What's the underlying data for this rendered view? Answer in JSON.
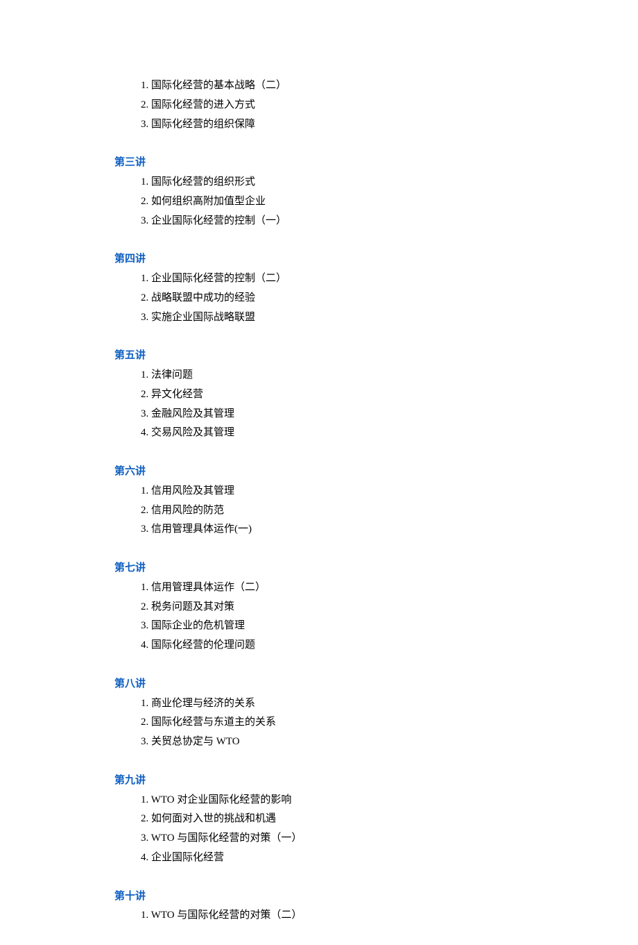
{
  "sections": [
    {
      "title": "",
      "items": [
        "1. 国际化经营的基本战略（二）",
        "2. 国际化经营的进入方式",
        "3. 国际化经营的组织保障"
      ]
    },
    {
      "title": "第三讲",
      "items": [
        "1. 国际化经营的组织形式",
        "2. 如何组织高附加值型企业",
        "3. 企业国际化经营的控制（一）"
      ]
    },
    {
      "title": "第四讲",
      "items": [
        "1. 企业国际化经营的控制（二）",
        "2. 战略联盟中成功的经验",
        "3. 实施企业国际战略联盟"
      ]
    },
    {
      "title": "第五讲",
      "items": [
        "1. 法律问题",
        "2. 异文化经营",
        "3. 金融风险及其管理",
        "4. 交易风险及其管理"
      ]
    },
    {
      "title": "第六讲",
      "items": [
        "1. 信用风险及其管理",
        "2. 信用风险的防范",
        "3. 信用管理具体运作(一)"
      ]
    },
    {
      "title": "第七讲",
      "items": [
        "1. 信用管理具体运作（二）",
        "2. 税务问题及其对策",
        "3. 国际企业的危机管理",
        "4. 国际化经营的伦理问题"
      ]
    },
    {
      "title": "第八讲",
      "items": [
        "1. 商业伦理与经济的关系",
        "2. 国际化经营与东道主的关系",
        "3. 关贸总协定与 WTO"
      ]
    },
    {
      "title": "第九讲",
      "items": [
        "1. WTO 对企业国际化经营的影响",
        "2. 如何面对入世的挑战和机遇",
        "3. WTO 与国际化经营的对策（一）",
        "4. 企业国际化经营"
      ]
    },
    {
      "title": "第十讲",
      "items": [
        "1. WTO 与国际化经营的对策（二）"
      ]
    }
  ]
}
